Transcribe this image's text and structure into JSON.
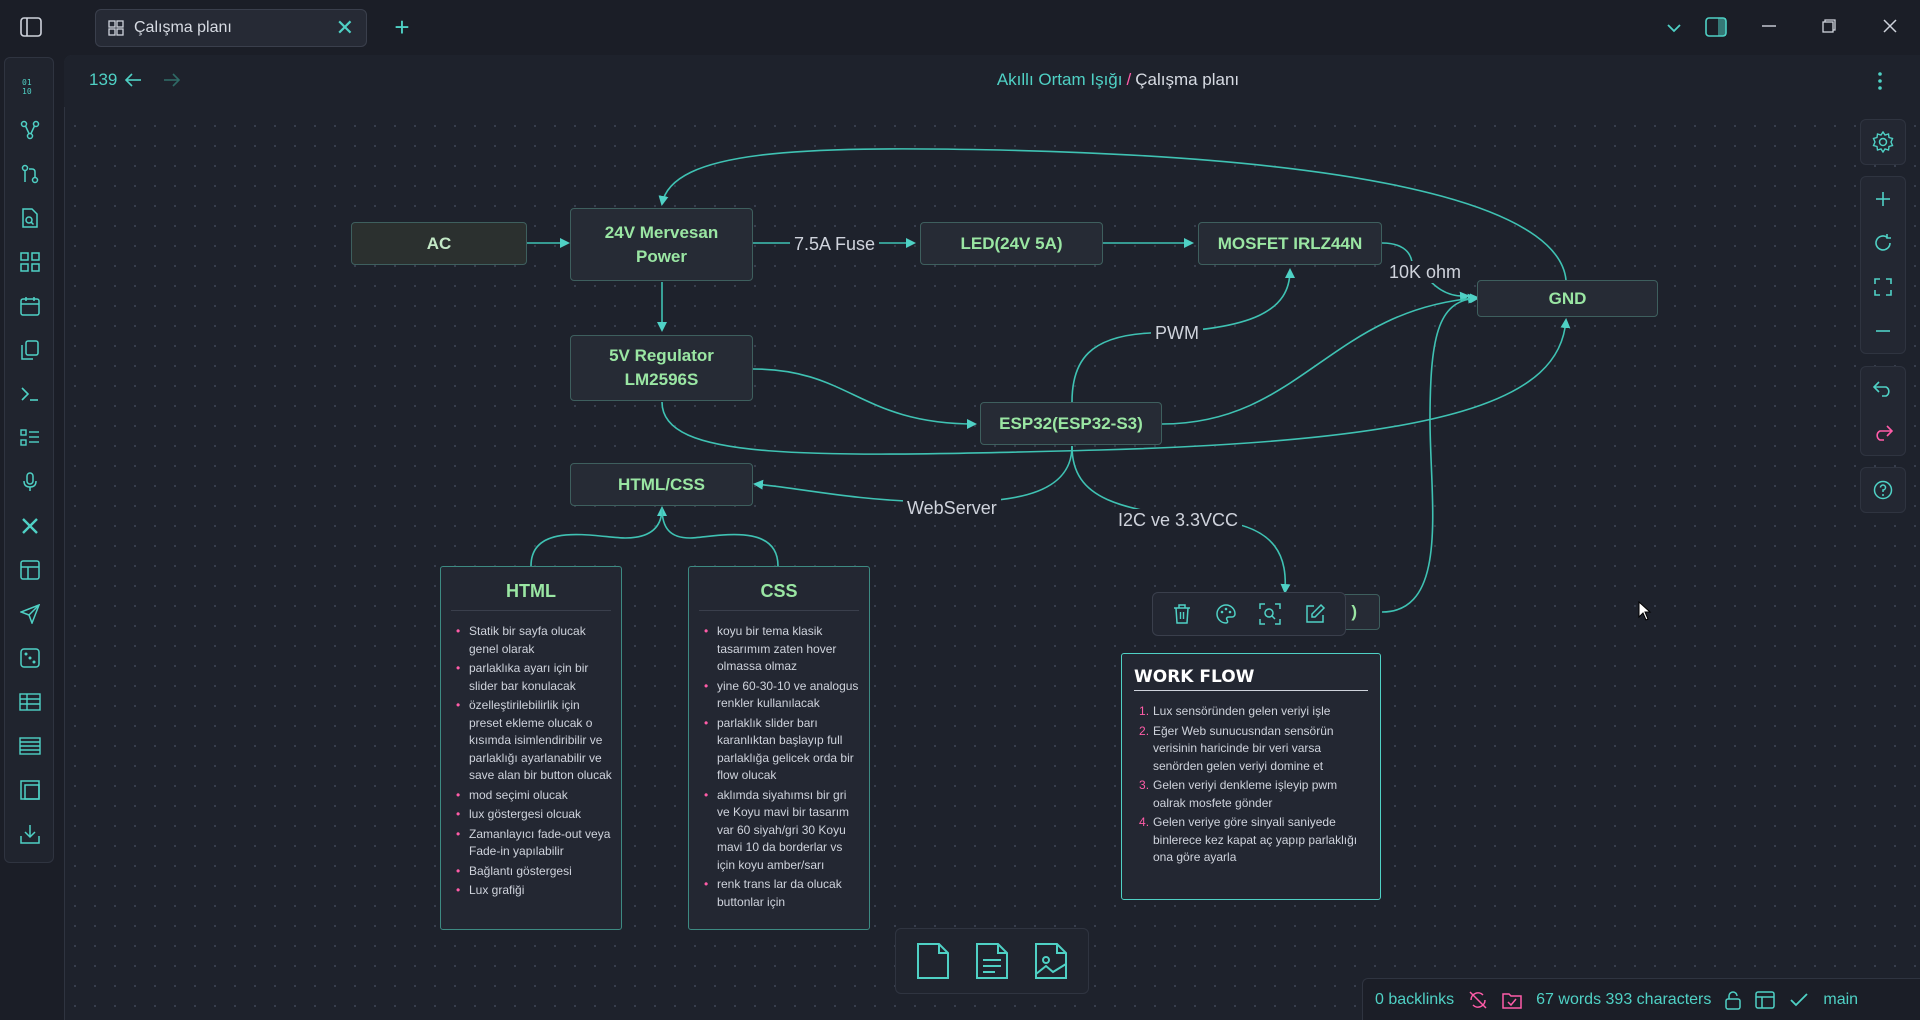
{
  "tab": {
    "title": "Çalışma planı"
  },
  "nav": {
    "counter": "139"
  },
  "breadcrumb": {
    "parent": "Akıllı Ortam Işığı",
    "separator": "/",
    "current": "Çalışma planı"
  },
  "nodes": {
    "ac": "AC",
    "power": "24V Mervesan\nPower",
    "led": "LED(24V 5A)",
    "mosfet": "MOSFET IRLZ44N",
    "gnd": "GND",
    "regulator": "5V Regulator\nLM2596S",
    "esp32": "ESP32(ESP32-S3)",
    "htmlcss": "HTML/CSS",
    "partial": ")"
  },
  "edges": {
    "fuse": "7.5A Fuse",
    "resistor": "10K ohm",
    "pwm": "PWM",
    "webserver": "WebServer",
    "i2c": "I2C ve 3.3VCC"
  },
  "html_card": {
    "title": "HTML",
    "items": [
      "Statik bir sayfa olucak genel olarak",
      "parlaklıka ayarı için bir slider bar konulacak",
      "özelleştirilebilirlik için preset ekleme olucak o kısımda isimlendiribilir ve parlaklığı ayarlanabilir ve save alan bir button olucak",
      "mod seçimi olucak",
      "lux göstergesi olcuak",
      "Zamanlayıcı fade-out veya Fade-in yapılabilir",
      "Bağlantı göstergesi",
      "Lux grafiği"
    ]
  },
  "css_card": {
    "title": "CSS",
    "items": [
      "koyu bir tema klasik tasarımım zaten hover olmassa olmaz",
      "yine 60-30-10 ve analogus renkler kullanılacak",
      "parlaklık slider barı karanlıktan başlayıp full parlaklığa gelicek orda bir flow olucak",
      "aklımda siyahımsı bir gri ve Koyu mavi bir tasarım var 60 siyah/gri 30 Koyu mavi 10 da borderlar vs için koyu amber/sarı",
      "renk trans lar da olucak buttonlar için"
    ]
  },
  "workflow": {
    "title": "WORK FLOW",
    "items": [
      "Lux sensöründen gelen veriyi işle",
      "Eğer Web sunucusndan sensörün verisinin haricinde bir veri varsa senörden gelen veriyi domine et",
      "Gelen veriyi denkleme işleyip pwm oalrak mosfete gönder",
      "Gelen veriye göre sinyali saniyede binlerece kez kapat aç yapıp parlaklığı ona göre ayarla"
    ]
  },
  "status": {
    "backlinks": "0 backlinks",
    "counts": "67 words 393 characters",
    "branch": "main"
  },
  "colors": {
    "accent": "#4fd1c5",
    "node_text": "#9ae6a3",
    "bullet": "#ff5ca8",
    "background": "#1e222c"
  }
}
